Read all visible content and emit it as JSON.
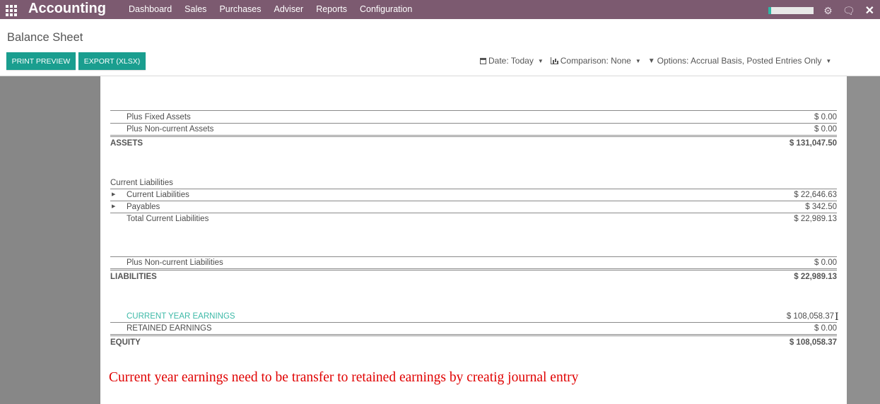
{
  "navbar": {
    "apps_icon": "apps-grid-icon",
    "title": "Accounting",
    "menu": [
      "Dashboard",
      "Sales",
      "Purchases",
      "Adviser",
      "Reports",
      "Configuration"
    ],
    "right_icons": [
      "user-status-icon",
      "settings-icon",
      "chat-icon",
      "close-icon"
    ],
    "brand_color": "#7c5a70"
  },
  "control": {
    "title": "Balance Sheet",
    "print_label": "PRINT PREVIEW",
    "export_label": "EXPORT (XLSX)",
    "date_filter": "Date: Today",
    "comparison_filter": "Comparison: None",
    "options_filter": "Options: Accrual Basis, Posted Entries Only",
    "accent_color": "#1a9e8f"
  },
  "report": {
    "fixed_assets": {
      "label": "Plus Fixed Assets",
      "value": "$ 0.00"
    },
    "noncurrent_assets": {
      "label": "Plus Non-current Assets",
      "value": "$ 0.00"
    },
    "assets": {
      "label": "ASSETS",
      "value": "$ 131,047.50"
    },
    "current_liabilities_header": "Current Liabilities",
    "current_liabilities": {
      "label": "Current Liabilities",
      "value": "$ 22,646.63"
    },
    "payables": {
      "label": "Payables",
      "value": "$ 342.50"
    },
    "total_current_liabilities": {
      "label": "Total Current Liabilities",
      "value": "$ 22,989.13"
    },
    "noncurrent_liabilities": {
      "label": "Plus Non-current Liabilities",
      "value": "$ 0.00"
    },
    "liabilities": {
      "label": "LIABILITIES",
      "value": "$ 22,989.13"
    },
    "current_year_earnings": {
      "label": "CURRENT YEAR EARNINGS",
      "value": "$ 108,058.37"
    },
    "retained_earnings": {
      "label": "RETAINED EARNINGS",
      "value": "$ 0.00"
    },
    "equity": {
      "label": "EQUITY",
      "value": "$ 108,058.37"
    }
  },
  "annotation": "Current year earnings need to be transfer to retained earnings by creatig journal entry"
}
